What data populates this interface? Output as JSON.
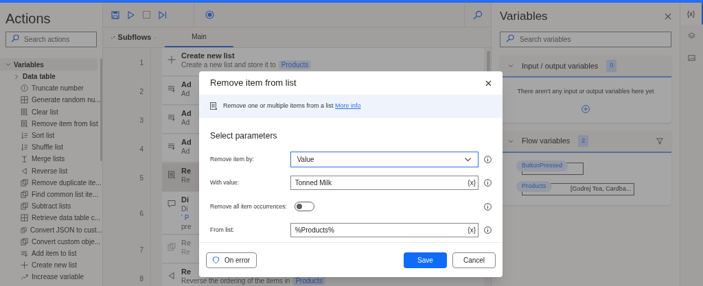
{
  "actions_panel": {
    "title": "Actions",
    "search": {
      "placeholder": "Search actions"
    },
    "tree": [
      {
        "label": "Variables",
        "expanded": true,
        "children": [
          {
            "label": "Data table",
            "kind": "group",
            "expanded": false
          },
          {
            "label": "Truncate number",
            "kind": "action"
          },
          {
            "label": "Generate random nu...",
            "kind": "action"
          },
          {
            "label": "Clear list",
            "kind": "action"
          },
          {
            "label": "Remove item from list",
            "kind": "action"
          },
          {
            "label": "Sort list",
            "kind": "action"
          },
          {
            "label": "Shuffle list",
            "kind": "action"
          },
          {
            "label": "Merge lists",
            "kind": "action"
          },
          {
            "label": "Reverse list",
            "kind": "action"
          },
          {
            "label": "Remove duplicate ite...",
            "kind": "action"
          },
          {
            "label": "Find common list ite...",
            "kind": "action"
          },
          {
            "label": "Subtract lists",
            "kind": "action"
          },
          {
            "label": "Retrieve data table c...",
            "kind": "action"
          },
          {
            "label": "Convert JSON to cust...",
            "kind": "action"
          },
          {
            "label": "Convert custom obje...",
            "kind": "action"
          },
          {
            "label": "Add item to list",
            "kind": "action"
          },
          {
            "label": "Create new list",
            "kind": "action"
          },
          {
            "label": "Increase variable",
            "kind": "action"
          }
        ]
      }
    ]
  },
  "editor": {
    "tabs": [
      {
        "label": "Main",
        "selected": true
      }
    ],
    "subflows": "Subflows",
    "steps": [
      {
        "number": "1",
        "title": "Create new list",
        "subtitle": "Create a new list and store it to",
        "token": "Products",
        "selected": false,
        "disabled": false
      },
      {
        "number": "2",
        "title": "Ad",
        "subtitle": "Ad",
        "selected": false,
        "disabled": false
      },
      {
        "number": "3",
        "title": "Ad",
        "subtitle": "Ad",
        "selected": false,
        "disabled": false
      },
      {
        "number": "4",
        "title": "Ad",
        "subtitle": "Ad",
        "selected": false,
        "disabled": false
      },
      {
        "number": "5",
        "title": "Re",
        "subtitle": "Re",
        "selected": true,
        "disabled": false
      },
      {
        "number": "6",
        "title": "Di",
        "subtitle": "Di",
        "more_lines": [
          "' P",
          "pre"
        ],
        "selected": false,
        "disabled": false
      },
      {
        "number": "7",
        "title": "Re",
        "subtitle": "Re",
        "selected": false,
        "disabled": true
      },
      {
        "number": "8",
        "title": "Re",
        "subtitle": "Reverse the ordering of the items in",
        "token": "Products",
        "selected": false,
        "disabled": false
      }
    ]
  },
  "variables_panel": {
    "title": "Variables",
    "search": {
      "placeholder": "Search variables"
    },
    "sections": [
      {
        "title": "Input / output variables",
        "count": "0",
        "expanded": true,
        "empty_text": "There aren't any input or output variables here yet"
      },
      {
        "title": "Flow variables",
        "count": "2",
        "expanded": true,
        "variables": [
          {
            "name": "ButtonPressed"
          },
          {
            "name": "Products",
            "value": "[Godrej Tea, Cardba..."
          }
        ]
      }
    ]
  },
  "side_strip": {
    "items": [
      {
        "label": "{x}",
        "selected": true
      },
      {
        "selected": false
      },
      {
        "selected": false
      }
    ]
  },
  "dialog": {
    "title": "Remove item from list",
    "info": "Remove one or multiple items from a list",
    "info_link": "More info",
    "section": "Select parameters",
    "fields": [
      {
        "label": "Remove item by:",
        "kind": "dropdown",
        "value": "Value"
      },
      {
        "label": "With value:",
        "kind": "text",
        "value": "Tonned Milk",
        "var_button": "{x}"
      },
      {
        "label": "Remove all item occurrences:",
        "kind": "toggle",
        "on": false
      },
      {
        "label": "From list:",
        "kind": "text",
        "value": "%Products%",
        "var_button": "{x}"
      }
    ],
    "on_error": "On error",
    "save": "Save",
    "cancel": "Cancel"
  }
}
